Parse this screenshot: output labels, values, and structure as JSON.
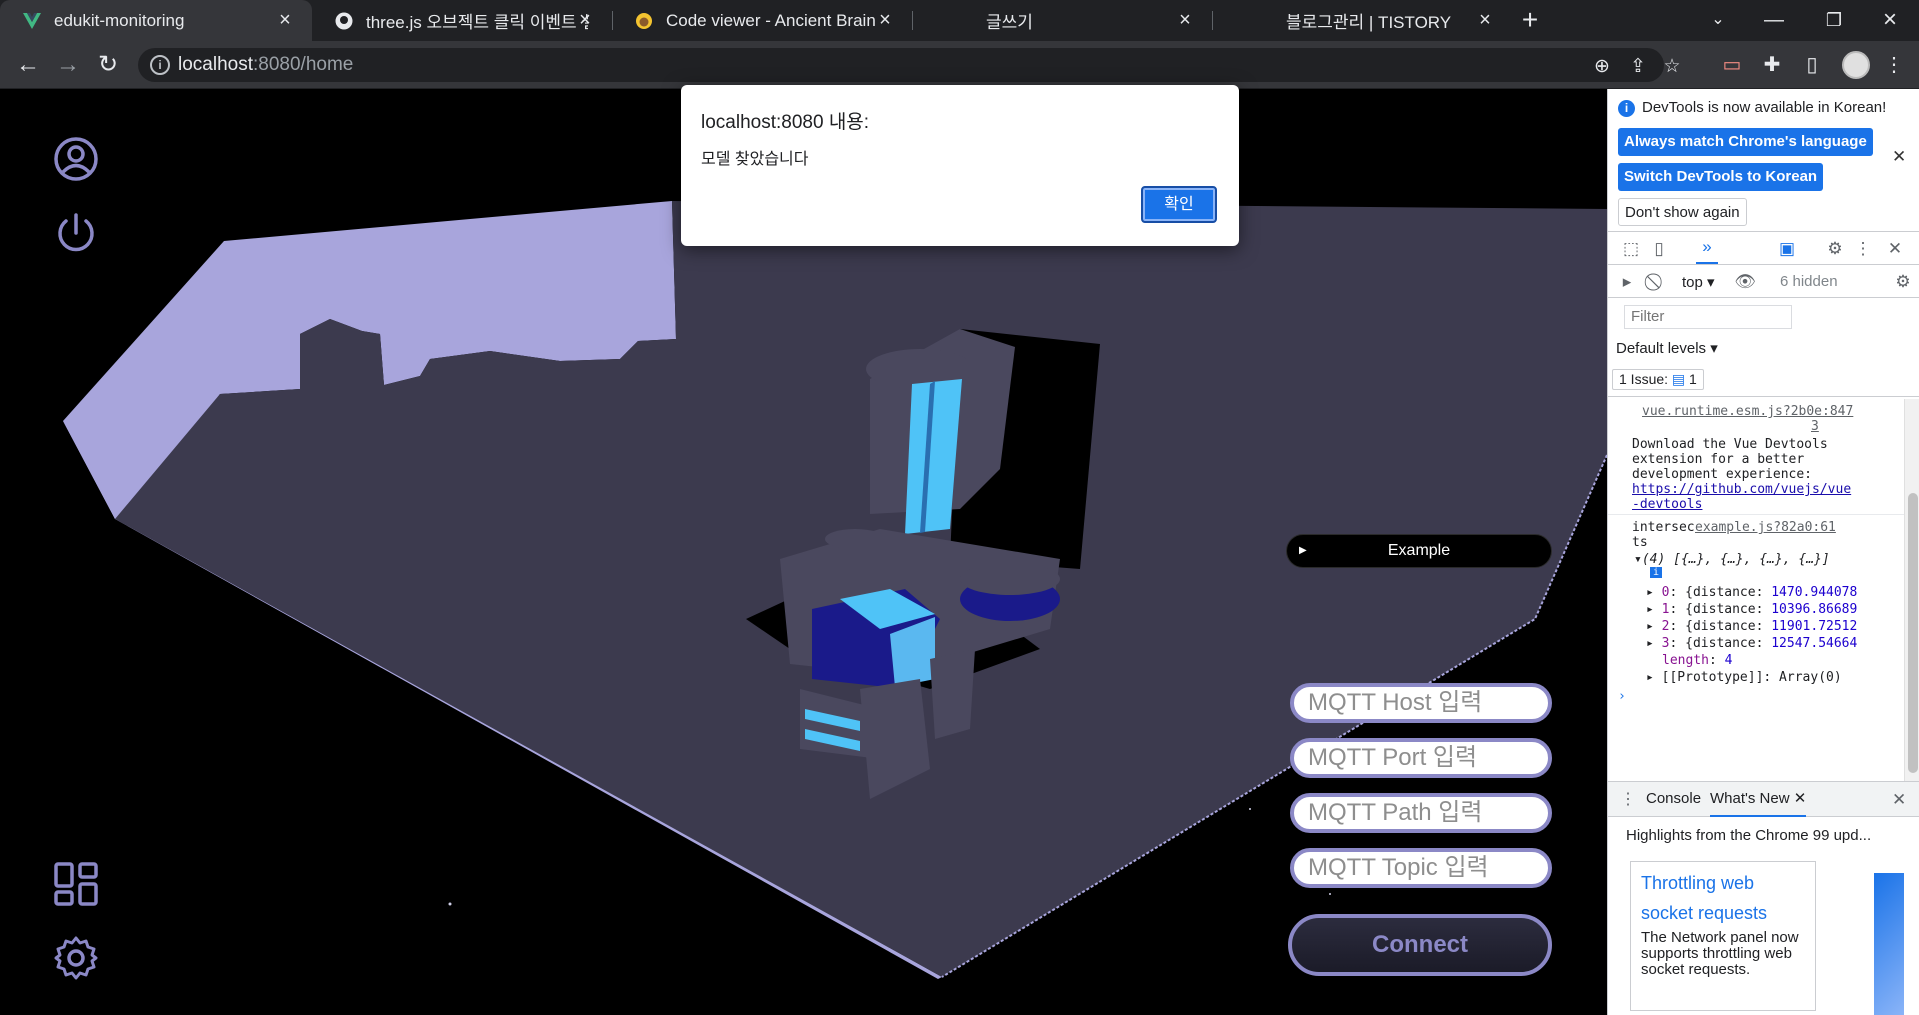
{
  "tabs": [
    {
      "title": "edukit-monitoring",
      "icon": "vue-icon",
      "active": true
    },
    {
      "title": "three.js 오브젝트 클릭 이벤트 설",
      "icon": "github-icon",
      "active": false
    },
    {
      "title": "Code viewer - Ancient Brain",
      "icon": "ancient-brain-icon",
      "active": false
    },
    {
      "title": "글쓰기",
      "icon": "",
      "active": false
    },
    {
      "title": "블로그관리 | TISTORY",
      "icon": "",
      "active": false
    }
  ],
  "address": {
    "host": "localhost",
    "rest": ":8080/home"
  },
  "dialog": {
    "title": "localhost:8080 내용:",
    "message": "모델 찾았습니다",
    "ok_label": "확인"
  },
  "app": {
    "example_label": "Example",
    "inputs": [
      {
        "placeholder": "MQTT Host 입력"
      },
      {
        "placeholder": "MQTT Port 입력"
      },
      {
        "placeholder": "MQTT Path 입력"
      },
      {
        "placeholder": "MQTT Topic 입력"
      }
    ],
    "connect_label": "Connect",
    "colors": {
      "accent": "#8b88c6",
      "floor": "#3c3a4e",
      "wall": "#a8a5dc",
      "cyan": "#4fc3f7",
      "navy": "#1a1a8a"
    }
  },
  "devtools": {
    "notice": "DevTools is now available in Korean!",
    "btn_match": "Always match Chrome's language",
    "btn_switch": "Switch DevTools to Korean",
    "btn_dont": "Don't show again",
    "context": "top",
    "hidden": "6 hidden",
    "filter_placeholder": "Filter",
    "levels": "Default levels",
    "issues_label": "1 Issue:",
    "issues_count": "1",
    "console": {
      "src1a": "vue.runtime.esm.js?2b0e:847",
      "src1b": "3",
      "msg1": [
        "Download the Vue Devtools",
        "extension for a better",
        "development experience:"
      ],
      "link1": [
        "https://github.com/vuejs/vue",
        "-devtools"
      ],
      "label2a": "intersec",
      "label2b": "ts",
      "src2": "example.js?82a0:61",
      "array_head": "(4) [{…}, {…}, {…}, {…}]",
      "entries": [
        {
          "key": "0",
          "value": "1470.944078"
        },
        {
          "key": "1",
          "value": "10396.86689"
        },
        {
          "key": "2",
          "value": "11901.72512"
        },
        {
          "key": "3",
          "value": "12547.54664"
        }
      ],
      "length_key": "length",
      "length_val": "4",
      "proto": "[[Prototype]]: Array(0)"
    },
    "drawer_tabs": [
      "Console",
      "What's New"
    ],
    "whats_new_head": "Highlights from the Chrome 99 upd...",
    "card_title": "Throttling web socket requests",
    "card_body": "The Network panel now supports throttling web socket requests."
  }
}
